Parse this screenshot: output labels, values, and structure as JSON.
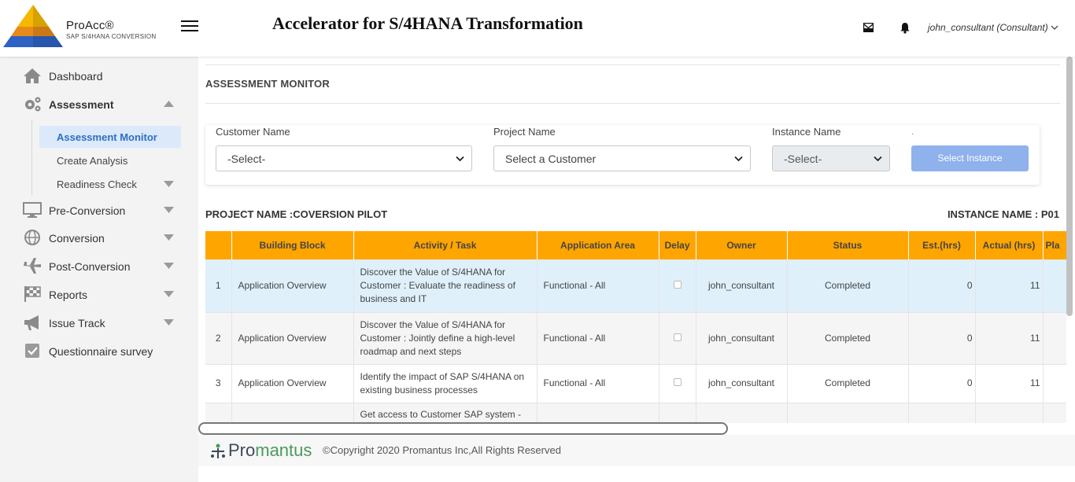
{
  "header": {
    "logo_name": "ProAcc®",
    "logo_subtitle": "SAP S/4HANA CONVERSION",
    "app_title": "Accelerator for S/4HANA Transformation",
    "user": "john_consultant (Consultant)"
  },
  "sidebar": {
    "items": [
      {
        "label": "Dashboard",
        "icon": "home-icon"
      },
      {
        "label": "Assessment",
        "icon": "gears-icon"
      },
      {
        "label": "Pre-Conversion",
        "icon": "monitor-icon"
      },
      {
        "label": "Conversion",
        "icon": "globe-icon"
      },
      {
        "label": "Post-Conversion",
        "icon": "airplane-icon"
      },
      {
        "label": "Reports",
        "icon": "flag-icon"
      },
      {
        "label": "Issue Track",
        "icon": "megaphone-icon"
      },
      {
        "label": "Questionnaire survey",
        "icon": "checkbox-icon"
      }
    ],
    "assessment_sub": [
      {
        "label": "Assessment Monitor"
      },
      {
        "label": "Create Analysis"
      },
      {
        "label": "Readiness Check"
      }
    ]
  },
  "main": {
    "heading": "ASSESSMENT MONITOR",
    "filters": {
      "customer_label": "Customer Name",
      "customer_value": "-Select-",
      "project_label": "Project Name",
      "project_value": "Select a Customer",
      "instance_label": "Instance Name",
      "instance_value": "-Select-",
      "dot": ".",
      "select_instance_button": "Select Instance"
    },
    "project_name": "PROJECT NAME :COVERSION PILOT",
    "instance_name": "INSTANCE NAME : P01"
  },
  "table": {
    "columns": [
      "",
      "Building Block",
      "Activity / Task",
      "Application Area",
      "Delay",
      "Owner",
      "Status",
      "Est.(hrs)",
      "Actual (hrs)",
      "Pla"
    ],
    "rows": [
      {
        "n": "1",
        "block": "Application Overview",
        "task": "Discover the Value of S/4HANA for Customer : Evaluate the readiness of business and IT",
        "area": "Functional - All",
        "owner": "john_consultant",
        "status": "Completed",
        "est": "0",
        "actual": "11"
      },
      {
        "n": "2",
        "block": "Application Overview",
        "task": "Discover the Value of S/4HANA for Customer : Jointly define a high-level roadmap and next steps",
        "area": "Functional - All",
        "owner": "john_consultant",
        "status": "Completed",
        "est": "0",
        "actual": "11"
      },
      {
        "n": "3",
        "block": "Application Overview",
        "task": "Identify the impact of SAP S/4HANA on existing business processes",
        "area": "Functional - All",
        "owner": "john_consultant",
        "status": "Completed",
        "est": "0",
        "actual": "11"
      },
      {
        "n": "",
        "block": "",
        "task": "Get access to Customer SAP system -",
        "area": "",
        "owner": "",
        "status": "",
        "est": "",
        "actual": ""
      }
    ]
  },
  "footer": {
    "logo_pro": "Pro",
    "logo_mantus": "mantus",
    "copyright": "©Copyright 2020 Promantus Inc,All Rights Reserved"
  },
  "colors": {
    "table_header": "#ffa500",
    "button": "#8fb1ec",
    "active_nav": "#dbe9fb",
    "selected_row": "#dff0fb"
  }
}
